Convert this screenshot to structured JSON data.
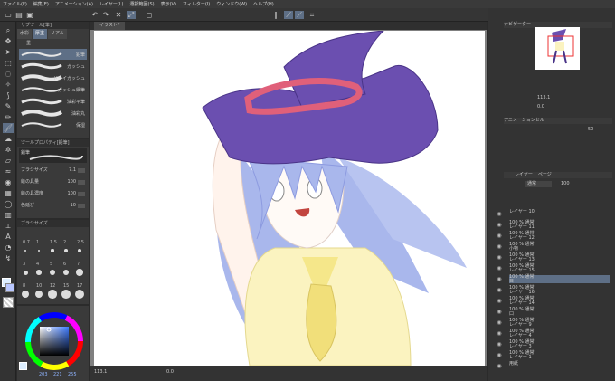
{
  "menubar": {
    "items": [
      "ファイル(F)",
      "編集(E)",
      "アニメーション(A)",
      "レイヤー(L)",
      "選択範囲(S)",
      "表示(V)",
      "フィルター(I)",
      "ウィンドウ(W)",
      "ヘルプ(H)"
    ]
  },
  "subtool": {
    "title": "サブツール[筆]",
    "tabs": [
      "水彩",
      "厚塗",
      "リアル"
    ],
    "group_label": "墨",
    "brushes": [
      {
        "name": "鉛筆",
        "selected": true
      },
      {
        "name": "ガッシュ",
        "selected": false
      },
      {
        "name": "ドライガッシュ",
        "selected": false
      },
      {
        "name": "ガッシュ細筆",
        "selected": false
      },
      {
        "name": "油彩平筆",
        "selected": false
      },
      {
        "name": "油彩丸",
        "selected": false
      },
      {
        "name": "保湿",
        "selected": false
      }
    ]
  },
  "tool_property": {
    "title": "ツールプロパティ[鉛筆]",
    "preview_label": "鉛筆",
    "rows": [
      {
        "label": "ブラシサイズ",
        "value": "7.1"
      },
      {
        "label": "絵の具量",
        "value": "100"
      },
      {
        "label": "絵の具濃度",
        "value": "100"
      },
      {
        "label": "色延び",
        "value": "10"
      }
    ]
  },
  "brush_size": {
    "title": "ブラシサイズ",
    "sizes": [
      "0.7",
      "1",
      "1.5",
      "2",
      "2.5",
      "3",
      "4",
      "5",
      "6",
      "7",
      "8",
      "10",
      "12",
      "15",
      "17"
    ]
  },
  "color": {
    "values": [
      "203",
      "221",
      "255"
    ],
    "main_color": "#ddeeff",
    "sub_color": "#b9c7ff"
  },
  "canvas": {
    "tab_label": "イラスト*",
    "zoom": "113.1",
    "rotation": "0.0"
  },
  "navigator": {
    "title": "ナビゲーター",
    "zoom": "113.1",
    "rotation": "0.0"
  },
  "animation_cels": {
    "title": "アニメーションセル",
    "opacity": "50"
  },
  "layers": {
    "tabs": [
      "レイヤー",
      "ページ"
    ],
    "blend_mode": "通常",
    "opacity": "100",
    "rows": [
      {
        "line1": "",
        "line2": "レイヤー 10",
        "selected": false
      },
      {
        "line1": "100 % 通常",
        "line2": "レイヤー 11",
        "selected": false
      },
      {
        "line1": "100 % 通常",
        "line2": "レイヤー 12",
        "selected": false
      },
      {
        "line1": "100 % 通常",
        "line2": "小物",
        "selected": false
      },
      {
        "line1": "100 % 通常",
        "line2": "レイヤー 13",
        "selected": false
      },
      {
        "line1": "100 % 通常",
        "line2": "レイヤー 15",
        "selected": false
      },
      {
        "line1": "100 % 通常",
        "line2": "目",
        "selected": true
      },
      {
        "line1": "100 % 通常",
        "line2": "レイヤー 16",
        "selected": false
      },
      {
        "line1": "100 % 通常",
        "line2": "レイヤー 14",
        "selected": false
      },
      {
        "line1": "100 % 通常",
        "line2": "口",
        "selected": false
      },
      {
        "line1": "100 % 通常",
        "line2": "レイヤー 9",
        "selected": false
      },
      {
        "line1": "100 % 通常",
        "line2": "レイヤー 4",
        "selected": false
      },
      {
        "line1": "100 % 通常",
        "line2": "レイヤー 3",
        "selected": false
      },
      {
        "line1": "100 % 通常",
        "line2": "レイヤー 1",
        "selected": false
      },
      {
        "line1": "",
        "line2": "用紙",
        "selected": false
      }
    ]
  },
  "accent_colors": {
    "selection": "#5e6f86",
    "hat": "#6b4fb0",
    "hat_band": "#e0607a",
    "hair": "#a9b7ec",
    "shirt": "#fbf3c0"
  }
}
